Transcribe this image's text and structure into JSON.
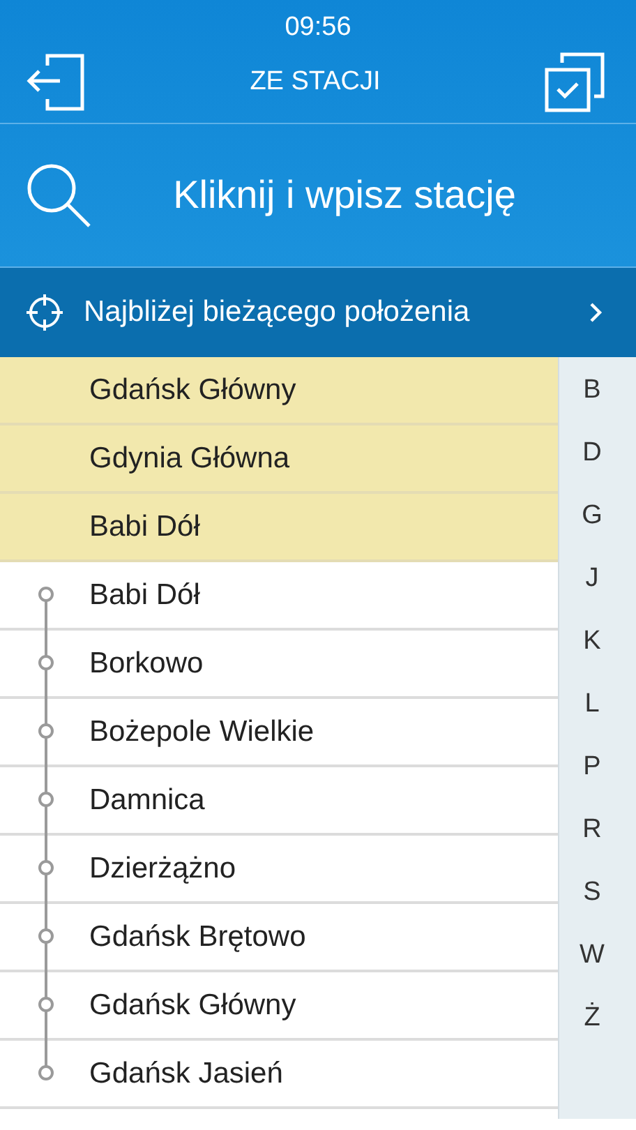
{
  "status_bar": {
    "time": "09:56"
  },
  "header": {
    "title": "ZE STACJI"
  },
  "search": {
    "placeholder": "Kliknij i wpisz stację"
  },
  "nearby": {
    "label": "Najbliżej bieżącego położenia"
  },
  "stations": [
    {
      "kind": "recent",
      "name": "Gdańsk Główny"
    },
    {
      "kind": "recent",
      "name": "Gdynia Główna"
    },
    {
      "kind": "recent",
      "name": "Babi Dół"
    },
    {
      "kind": "station",
      "name": "Babi Dół"
    },
    {
      "kind": "station",
      "name": "Borkowo"
    },
    {
      "kind": "station",
      "name": "Bożepole Wielkie"
    },
    {
      "kind": "station",
      "name": "Damnica"
    },
    {
      "kind": "station",
      "name": "Dzierżążno"
    },
    {
      "kind": "station",
      "name": "Gdańsk Brętowo"
    },
    {
      "kind": "station",
      "name": "Gdańsk Główny"
    },
    {
      "kind": "station",
      "name": "Gdańsk Jasień"
    }
  ],
  "index": [
    "B",
    "D",
    "G",
    "J",
    "K",
    "L",
    "P",
    "R",
    "S",
    "W",
    "Ż"
  ]
}
